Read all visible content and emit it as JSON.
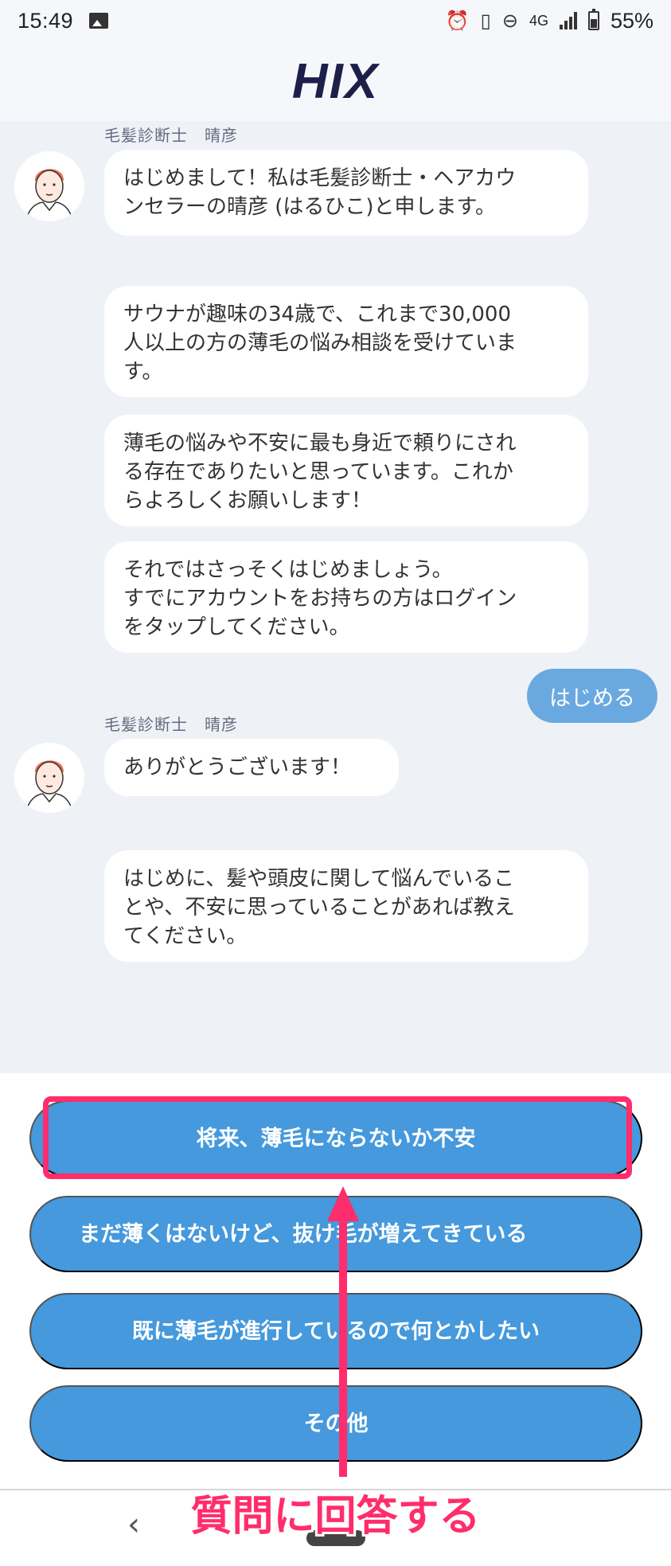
{
  "status_bar": {
    "time": "15:49",
    "network": "4G",
    "battery": "55%",
    "icons": [
      "image-icon",
      "alarm-icon",
      "vibrate-icon",
      "dnd-icon",
      "signal-icon",
      "battery-icon"
    ]
  },
  "header": {
    "logo": "HIX"
  },
  "chat": {
    "messages": [
      {
        "sender": "毛髪診断士　晴彦"
      },
      {
        "text": "はじめまして！私は毛髪診断士・ヘアカウ\nンセラーの晴彦 (はるひこ)と申します。"
      },
      {
        "text": "サウナが趣味の34歳で、これまで30,000\n人以上の方の薄毛の悩み相談を受けていま\nす。"
      },
      {
        "text": "薄毛の悩みや不安に最も身近で頼りにされ\nる存在でありたいと思っています。これか\nらよろしくお願いします！"
      },
      {
        "text": "それではさっそくはじめましょう。\nすでにアカウントをお持ちの方はログイン\nをタップしてください。"
      },
      {
        "user_text": "はじめる"
      },
      {
        "sender": "毛髪診断士　晴彦"
      },
      {
        "text": "ありがとうございます！"
      },
      {
        "text": "はじめに、髪や頭皮に関して悩んでいるこ\nとや、不安に思っていることがあれば教え\nてください。"
      }
    ]
  },
  "options": [
    {
      "label": "将来、薄毛にならないか不安"
    },
    {
      "label": "まだ薄くはないけど、抜け毛が増えてきている"
    },
    {
      "label": "既に薄毛が進行しているので何とかしたい"
    },
    {
      "label": "その他"
    }
  ],
  "annotation": {
    "text": "質問に回答する",
    "color": "#ff2d6b"
  },
  "colors": {
    "accent": "#4599dc",
    "user_bubble": "#6aa9e0",
    "chat_bg": "#eef2f7",
    "logo": "#1d1f4a"
  }
}
